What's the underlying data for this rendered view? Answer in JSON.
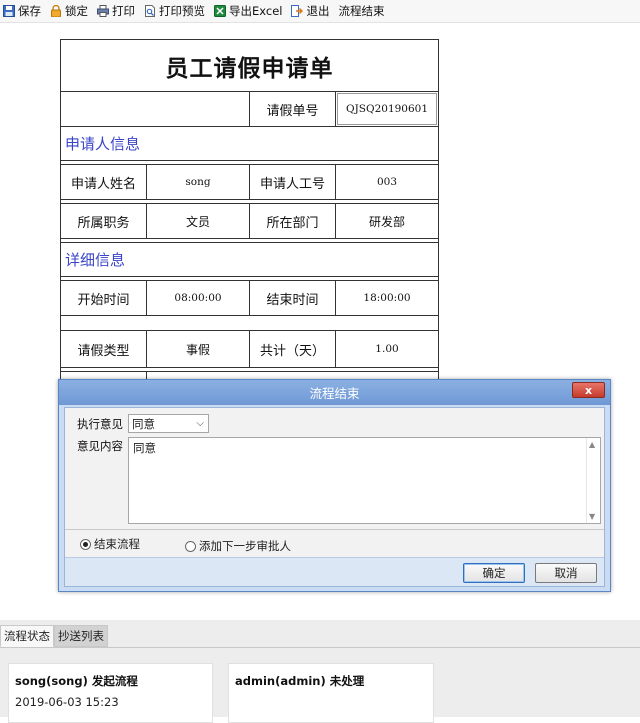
{
  "toolbar": {
    "items": [
      {
        "label": "保存",
        "icon": "save-icon"
      },
      {
        "label": "锁定",
        "icon": "lock-icon"
      },
      {
        "label": "打印",
        "icon": "print-icon"
      },
      {
        "label": "打印预览",
        "icon": "print-preview-icon"
      },
      {
        "label": "导出Excel",
        "icon": "excel-icon"
      },
      {
        "label": "退出",
        "icon": "exit-icon"
      },
      {
        "label": "流程结束",
        "icon": ""
      }
    ]
  },
  "form": {
    "title": "员工请假申请单",
    "number_label": "请假单号",
    "number_value": "QJSQ20190601",
    "section_applicant": "申请人信息",
    "name_label": "申请人姓名",
    "name_value": "song",
    "empno_label": "申请人工号",
    "empno_value": "003",
    "position_label": "所属职务",
    "position_value": "文员",
    "dept_label": "所在部门",
    "dept_value": "研发部",
    "section_detail": "详细信息",
    "start_label": "开始时间",
    "start_value": "08:00:00",
    "end_label": "结束时间",
    "end_value": "18:00:00",
    "type_label": "请假类型",
    "type_value": "事假",
    "total_label": "共计（天）",
    "total_value": "1.00"
  },
  "dialog": {
    "title": "流程结束",
    "close": "x",
    "opinion_label": "执行意见",
    "opinion_value": "同意",
    "content_label": "意见内容",
    "content_value": "同意",
    "radio_end": "结束流程",
    "radio_next": "添加下一步审批人",
    "ok": "确定",
    "cancel": "取消"
  },
  "bottom": {
    "tab_status": "流程状态",
    "tab_cc": "抄送列表",
    "cards": [
      {
        "who": "song(song)  发起流程",
        "when": "2019-06-03 15:23"
      },
      {
        "who": "admin(admin) 未处理",
        "when": ""
      }
    ]
  },
  "colors": {
    "section_text": "#3a44c8",
    "dialog_title_bg": "#7aa1d9",
    "close_button": "#d0463a"
  }
}
